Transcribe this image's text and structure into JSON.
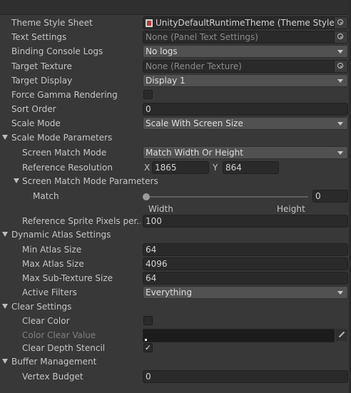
{
  "rows": {
    "theme_style_sheet": {
      "label": "Theme Style Sheet",
      "value": "UnityDefaultRuntimeTheme (Theme Style Sheet)"
    },
    "text_settings": {
      "label": "Text Settings",
      "value": "None (Panel Text Settings)"
    },
    "binding_console_logs": {
      "label": "Binding Console Logs",
      "value": "No logs"
    },
    "target_texture": {
      "label": "Target Texture",
      "value": "None (Render Texture)"
    },
    "target_display": {
      "label": "Target Display",
      "value": "Display 1"
    },
    "force_gamma": {
      "label": "Force Gamma Rendering",
      "checked": false
    },
    "sort_order": {
      "label": "Sort Order",
      "value": "0"
    },
    "scale_mode": {
      "label": "Scale Mode",
      "value": "Scale With Screen Size"
    },
    "scale_mode_params": {
      "label": "Scale Mode Parameters"
    },
    "screen_match_mode": {
      "label": "Screen Match Mode",
      "value": "Match Width Or Height"
    },
    "reference_resolution": {
      "label": "Reference Resolution",
      "x_label": "X",
      "x_value": "1865",
      "y_label": "Y",
      "y_value": "864"
    },
    "screen_match_params": {
      "label": "Screen Match Mode Parameters"
    },
    "match": {
      "label": "Match",
      "value": "0",
      "level": 0,
      "min_label": "Width",
      "max_label": "Height"
    },
    "ref_sprite_ppu": {
      "label": "Reference Sprite Pixels per...",
      "value": "100"
    },
    "dynamic_atlas": {
      "label": "Dynamic Atlas Settings"
    },
    "min_atlas_size": {
      "label": "Min Atlas Size",
      "value": "64"
    },
    "max_atlas_size": {
      "label": "Max Atlas Size",
      "value": "4096"
    },
    "max_subtexture_size": {
      "label": "Max Sub-Texture Size",
      "value": "64"
    },
    "active_filters": {
      "label": "Active Filters",
      "value": "Everything"
    },
    "clear_settings": {
      "label": "Clear Settings"
    },
    "clear_color": {
      "label": "Clear Color",
      "checked": false
    },
    "color_clear_value": {
      "label": "Color Clear Value",
      "color": "#1c1c1c"
    },
    "clear_depth_stencil": {
      "label": "Clear Depth Stencil",
      "checked": true,
      "check_glyph": "✓"
    },
    "buffer_management": {
      "label": "Buffer Management"
    },
    "vertex_budget": {
      "label": "Vertex Budget",
      "value": "0"
    }
  }
}
